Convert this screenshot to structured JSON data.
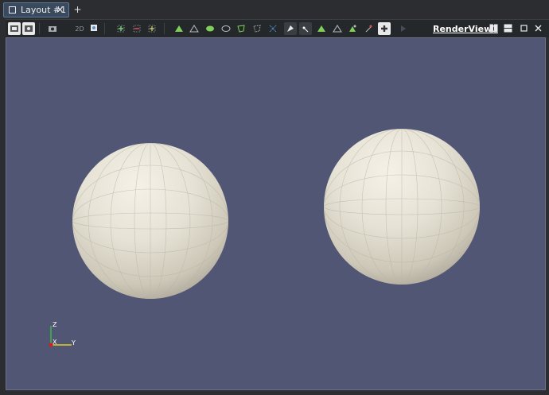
{
  "tab": {
    "label": "Layout #1",
    "close_glyph": "✕",
    "add_glyph": "+"
  },
  "toolbar": {
    "mode_2d_label": "2D",
    "icons": [
      "reset-camera-icon",
      "reset-camera-closest-icon",
      "capture-screenshot-icon",
      "mode-2d-icon",
      "zoom-to-box-icon",
      "rotate-plus-x-icon",
      "rotate-minus-x-icon",
      "rotate-view-icon",
      "select-cells-on-icon",
      "select-points-on-icon",
      "select-cells-through-icon",
      "select-points-through-icon",
      "select-cells-polygon-icon",
      "select-points-polygon-icon",
      "interactive-select-cells-icon",
      "interactive-select-points-icon",
      "hover-points-icon",
      "hover-cells-icon",
      "grow-selection-icon",
      "shrink-selection-icon",
      "clear-selection-icon",
      "add-selection-icon"
    ]
  },
  "renderview": {
    "title": "RenderView1",
    "buttons": [
      "split-horizontal-icon",
      "split-vertical-icon",
      "maximize-icon",
      "close-icon"
    ],
    "close_glyph": "✕"
  },
  "scene": {
    "background": "#525675",
    "sphere_color": "#e8e4d8",
    "spheres": [
      {
        "name": "sphere-left"
      },
      {
        "name": "sphere-right"
      }
    ],
    "axes": {
      "x_label": "X",
      "y_label": "Y",
      "z_label": "Z"
    }
  }
}
